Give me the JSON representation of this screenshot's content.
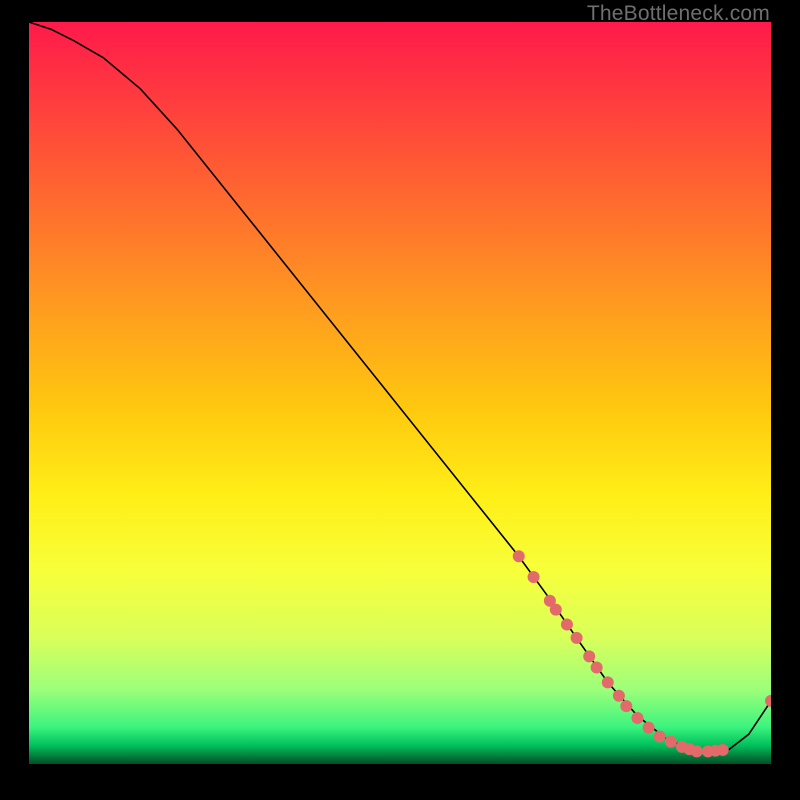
{
  "watermark": "TheBottleneck.com",
  "chart_data": {
    "type": "line",
    "title": "",
    "xlabel": "",
    "ylabel": "",
    "xlim": [
      0,
      100
    ],
    "ylim": [
      0,
      100
    ],
    "curve": {
      "x": [
        0,
        3,
        6,
        10,
        15,
        20,
        30,
        40,
        50,
        60,
        66,
        70,
        74,
        78,
        82,
        86,
        90,
        94,
        97,
        100
      ],
      "y": [
        100,
        99,
        97.5,
        95.2,
        91,
        85.5,
        73.0,
        60.5,
        48.0,
        35.5,
        28.0,
        22.5,
        16.7,
        11.0,
        6.5,
        3.3,
        1.7,
        1.7,
        4.0,
        8.5
      ]
    },
    "markers": {
      "x": [
        66.0,
        68.0,
        70.2,
        71.0,
        72.5,
        73.8,
        75.5,
        76.5,
        78.0,
        79.5,
        80.5,
        82.0,
        83.5,
        85.0,
        86.5,
        88.0,
        89.0,
        90.0,
        91.5,
        92.5,
        93.5,
        100.0
      ],
      "y": [
        28.0,
        25.2,
        22.0,
        20.8,
        18.8,
        17.0,
        14.5,
        13.0,
        11.0,
        9.2,
        7.8,
        6.2,
        4.9,
        3.7,
        3.0,
        2.3,
        2.0,
        1.7,
        1.7,
        1.8,
        1.9,
        8.5
      ],
      "color": "#e36a6a",
      "radius": 6
    }
  }
}
